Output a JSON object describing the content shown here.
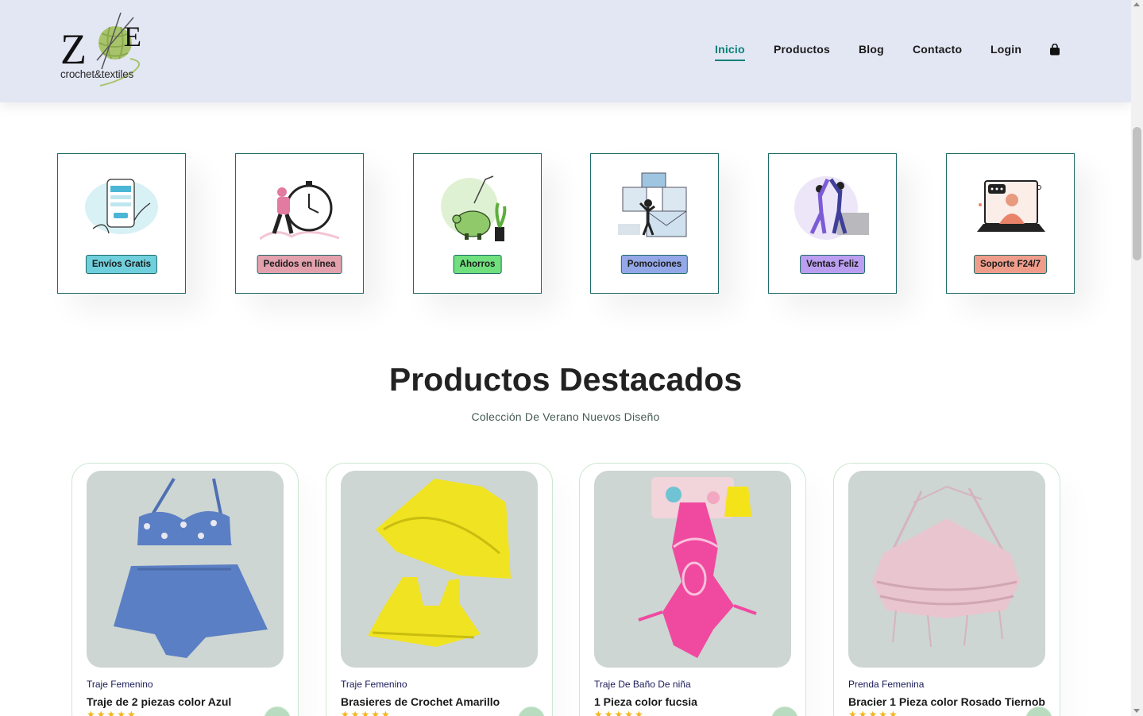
{
  "header": {
    "logo_wordmark": "crochet&textiles",
    "logo_letters": "ZOE",
    "nav": [
      {
        "label": "Inicio",
        "active": true
      },
      {
        "label": "Productos",
        "active": false
      },
      {
        "label": "Blog",
        "active": false
      },
      {
        "label": "Contacto",
        "active": false
      },
      {
        "label": "Login",
        "active": false
      }
    ],
    "cart_icon": "shopping-bag-icon",
    "accent": "#088178"
  },
  "features": [
    {
      "label": "Envíos Gratis",
      "color": "#6fcfdc",
      "icon": "phone-payment-icon"
    },
    {
      "label": "Pedidos en línea",
      "color": "#e3a0ad",
      "icon": "stopwatch-delivery-icon"
    },
    {
      "label": "Ahorros",
      "color": "#6fe07d",
      "icon": "piggy-bank-icon"
    },
    {
      "label": "Pomociones",
      "color": "#94a8e8",
      "icon": "promotions-icon"
    },
    {
      "label": "Ventas Feliz",
      "color": "#bb9ef0",
      "icon": "high-five-icon"
    },
    {
      "label": "Soporte F24/7",
      "color": "#ef9d8b",
      "icon": "support-laptop-icon"
    }
  ],
  "products_section": {
    "title": "Productos Destacados",
    "subtitle": "Colección De Verano Nuevos Diseño"
  },
  "products": [
    {
      "brand": "Traje Femenino",
      "name": "Traje de 2 piezas color Azul",
      "stars": "★★★★★",
      "rating": 5,
      "garment_color": "#5b7fc4"
    },
    {
      "brand": "Traje Femenino",
      "name": "Brasieres de Crochet Amarillo",
      "stars": "★★★★★",
      "rating": 5,
      "garment_color": "#f0e321"
    },
    {
      "brand": "Traje De Baño De niña",
      "name": "1 Pieza color fucsia",
      "stars": "★★★★★",
      "rating": 5,
      "garment_color": "#f04aa0"
    },
    {
      "brand": "Prenda Femenina",
      "name": "Bracier 1 Pieza color Rosado Tiernob",
      "stars": "★★★★★",
      "rating": 5,
      "garment_color": "#e9c5cf"
    }
  ]
}
